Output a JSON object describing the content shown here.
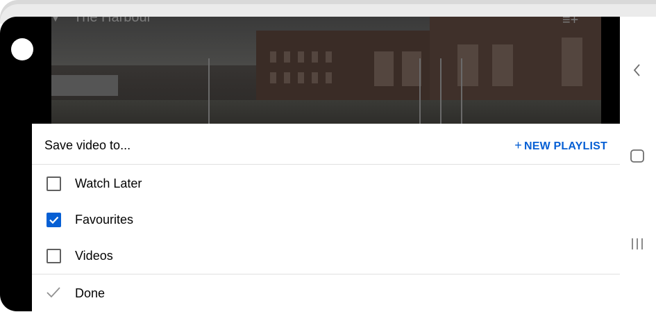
{
  "video": {
    "title": "The Harbour"
  },
  "sheet": {
    "title": "Save video to...",
    "new_playlist_label": "NEW PLAYLIST",
    "new_playlist_plus": "+",
    "playlists": [
      {
        "label": "Watch Later",
        "checked": false
      },
      {
        "label": "Favourites",
        "checked": true
      },
      {
        "label": "Videos",
        "checked": false
      }
    ],
    "done_label": "Done"
  },
  "nav": {
    "back": "back-icon",
    "home": "home-icon",
    "recents": "recents-icon"
  },
  "colors": {
    "accent": "#065fd4",
    "text": "#030303",
    "divider": "#e0e0e0"
  }
}
